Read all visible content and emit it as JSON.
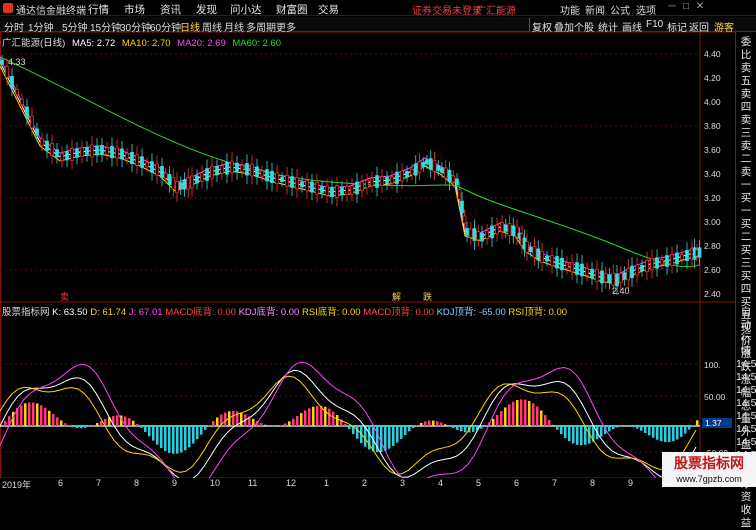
{
  "app": {
    "name": "通达信金融终端"
  },
  "menu": [
    "行情",
    "市场",
    "资讯",
    "发现",
    "问小达",
    "财富圈",
    "交易"
  ],
  "notice": "证券交易未登录",
  "broker": "广汇能源",
  "right_menu": [
    "功能",
    "新闻",
    "公式",
    "选项"
  ],
  "guest": "游客",
  "period_tabs": [
    "分时",
    "1分钟",
    "5分钟",
    "15分钟",
    "30分钟",
    "60分钟",
    "日线",
    "周线",
    "月线",
    "多周期",
    "更多"
  ],
  "active_tab": "日线",
  "tool_buttons": [
    "复权",
    "叠加",
    "个股",
    "统计",
    "画线",
    "F10",
    "标记",
    "返回"
  ],
  "main_header": {
    "stock": "广汇能源(日线)",
    "ma5": "MA5: 2.72",
    "ma10": "MA10: 2.70",
    "ma20": "MA20: 2.69",
    "ma60": "MA60: 2.60",
    "colors": {
      "ma5": "#ffffff",
      "ma10": "#ffd400",
      "ma20": "#ff44ff",
      "ma60": "#22dd22"
    }
  },
  "sub_header": {
    "name": "股票指标网",
    "k": "K: 63.50",
    "d": "D: 61.74",
    "j": "J: 67.01",
    "items": [
      "MACD底背: 0.00",
      "KDJ底背: 0.00",
      "RSI底背: 0.00",
      "MACD顶背: 0.00",
      "KDJ顶背: -65.00",
      "RSI顶背: 0.00"
    ]
  },
  "price_axis": [
    "4.40",
    "4.20",
    "4.00",
    "3.80",
    "3.60",
    "3.40",
    "3.20",
    "3.00",
    "2.80",
    "2.60",
    "2.40"
  ],
  "osc_axis": [
    "100.",
    "50.00",
    "0.00",
    "-50.00"
  ],
  "osc_current": "1.37",
  "annotations": {
    "high": "4.33",
    "low": "2.40",
    "sell": "卖",
    "buy": "买",
    "jie": "解",
    "di": "跌"
  },
  "side_panel": [
    "委比",
    "卖五",
    "卖四",
    "卖三",
    "卖二",
    "卖一",
    "买一",
    "买二",
    "买三",
    "买四",
    "买五",
    "现价",
    "涨跌",
    "涨幅",
    "总量",
    "外盘",
    "换手",
    "净资",
    "收益",
    "自动",
    "行情",
    "14:50",
    "14:50",
    "14:50",
    "14:50",
    "14:50",
    "14:50",
    "14:50",
    "14:50"
  ],
  "xaxis": [
    "2019年",
    "6",
    "7",
    "8",
    "9",
    "10",
    "11",
    "12",
    "1",
    "2",
    "3",
    "4",
    "5",
    "6",
    "7",
    "8",
    "9",
    "10",
    "11"
  ],
  "watermark": {
    "title": "股票指标网",
    "url": "www.7gpzb.com"
  }
}
